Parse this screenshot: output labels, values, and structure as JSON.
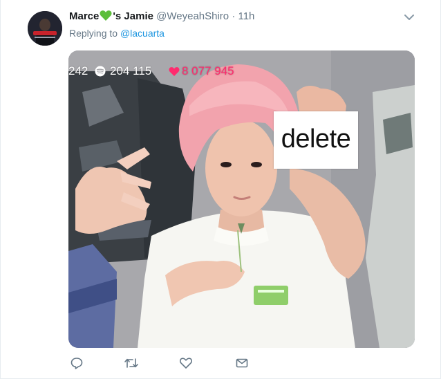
{
  "tweet": {
    "author_name_start": "Marce",
    "author_name_end": "'s Jamie",
    "name_emoji": "green-heart-icon",
    "handle": "@WeyeahShiro",
    "separator": "·",
    "time": "11h",
    "replying_prefix": "Replying to",
    "replying_handle": "@lacuarta"
  },
  "media": {
    "stat_1": "242",
    "stat_2": "204 115",
    "stat_3": "8 077 945",
    "card_text": "delete"
  },
  "actions": [
    "reply-icon",
    "retweet-icon",
    "like-icon",
    "message-icon"
  ],
  "colors": {
    "name": "#14171a",
    "muted": "#657786",
    "link": "#1b95e0",
    "stat_heart": "#ff2b6e",
    "emoji_heart": "#5cbe3a"
  }
}
